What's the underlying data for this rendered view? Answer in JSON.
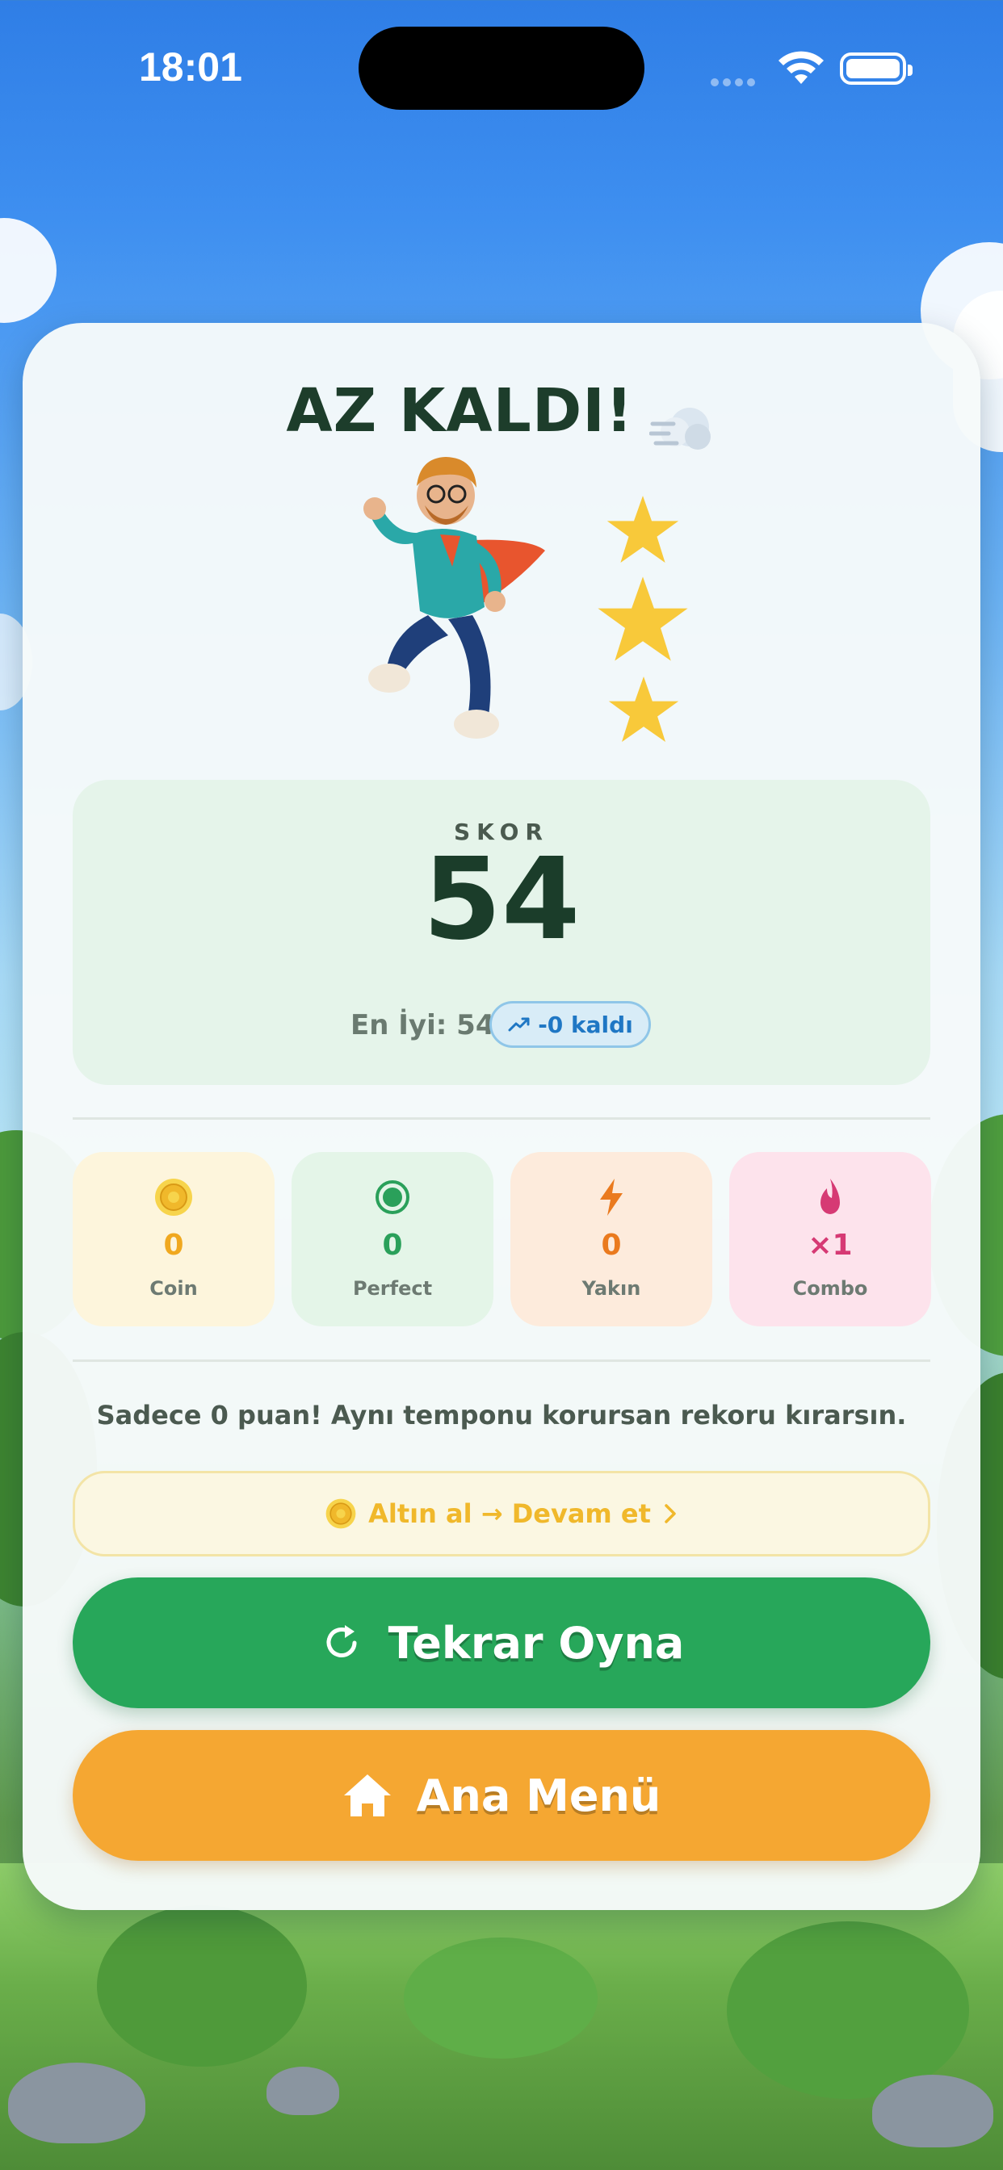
{
  "status_bar": {
    "time": "18:01"
  },
  "result": {
    "title": "AZ KALDI!",
    "stars_earned": 3,
    "score_label": "SKOR",
    "score_value": "54",
    "best_label": "En İyi: 54",
    "gap_badge": "-0 kaldı"
  },
  "stats": [
    {
      "value": "0",
      "label": "Coin",
      "icon": "coin-icon",
      "color": "#f0a81f",
      "bg": "#fdf5dc"
    },
    {
      "value": "0",
      "label": "Perfect",
      "icon": "target-icon",
      "color": "#2aa05a",
      "bg": "#e4f5e8"
    },
    {
      "value": "0",
      "label": "Yakın",
      "icon": "lightning-icon",
      "color": "#ea7a1e",
      "bg": "#fdebdc"
    },
    {
      "value": "×1",
      "label": "Combo",
      "icon": "flame-icon",
      "color": "#d63a74",
      "bg": "#fde3ec"
    }
  ],
  "message": "Sadece 0 puan! Aynı temponu korursan rekoru kırarsın.",
  "continue_button": {
    "label": "Altın al → Devam et",
    "icon": "coin-icon"
  },
  "replay_button": {
    "label": "Tekrar Oyna",
    "icon": "refresh-icon"
  },
  "menu_button": {
    "label": "Ana Menü",
    "icon": "home-icon"
  }
}
